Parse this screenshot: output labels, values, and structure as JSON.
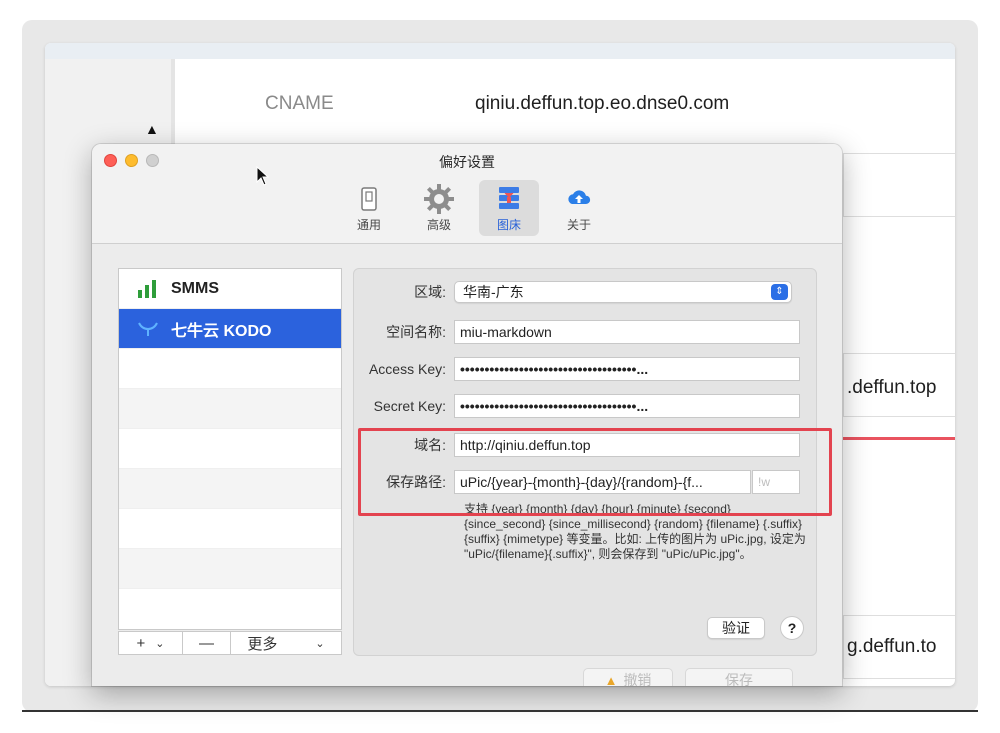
{
  "background": {
    "cname_label": "CNAME",
    "cname_value": "qiniu.deffun.top.eo.dnse0.com",
    "domain_row_1": ".deffun.top",
    "domain_row_2": "g.deffun.to",
    "chevron": "⌄"
  },
  "window": {
    "title": "偏好设置",
    "traffic_lights": [
      "close",
      "minimize",
      "zoom"
    ]
  },
  "toolbar": {
    "tabs": [
      {
        "label": "通用",
        "icon": "switch-icon",
        "active": false
      },
      {
        "label": "高级",
        "icon": "gear-icon",
        "active": false
      },
      {
        "label": "图床",
        "icon": "image-host-icon",
        "active": true
      },
      {
        "label": "关于",
        "icon": "cloud-upload-icon",
        "active": false
      }
    ]
  },
  "sidebar": {
    "items": [
      {
        "label": "SMMS",
        "icon": "smms-bars-icon",
        "selected": false
      },
      {
        "label": "七牛云 KODO",
        "icon": "qiniu-bull-icon",
        "selected": true
      }
    ],
    "empty_rows": 7,
    "add_label": "+",
    "add_chevron": "⌄",
    "remove_label": "—",
    "more_label": "更多",
    "more_chevron": "⌄"
  },
  "form": {
    "region_label": "区域:",
    "region_value": "华南-广东",
    "bucket_label": "空间名称:",
    "bucket_value": "miu-markdown",
    "access_key_label": "Access Key:",
    "access_key_value": "••••••••••••••••••••••••••••••••••••...",
    "secret_key_label": "Secret Key:",
    "secret_key_value": "••••••••••••••••••••••••••••••••••••...",
    "domain_label": "域名:",
    "domain_value": "http://qiniu.deffun.top",
    "save_path_label": "保存路径:",
    "save_path_value": "uPic/{year}-{month}-{day}/{random}-{f...",
    "suffix_placeholder": "!w",
    "help_text": "支持 {year} {month} {day} {hour} {minute} {second} {since_second} {since_millisecond} {random} {filename} {.suffix} {suffix} {mimetype} 等变量。比如: 上传的图片为 uPic.jpg, 设定为 \"uPic/{filename}{.suffix}\", 则会保存到 \"uPic/uPic.jpg\"。",
    "verify_label": "验证",
    "help_button": "?"
  },
  "actions": {
    "undo_label": "撤销",
    "save_label": "保存"
  },
  "colors": {
    "accent": "#2b62dd",
    "highlight_box": "#e3434f",
    "smms_green": "#2e9d3a"
  }
}
